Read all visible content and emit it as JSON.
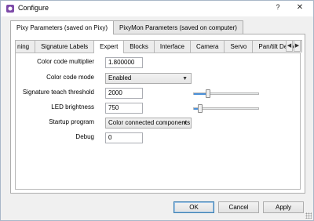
{
  "window": {
    "title": "Configure",
    "help_symbol": "?",
    "close_symbol": "✕"
  },
  "outer_tabs": [
    {
      "label": "Pixy Parameters (saved on Pixy)",
      "active": true
    },
    {
      "label": "PixyMon Parameters (saved on computer)",
      "active": false
    }
  ],
  "inner_tabs": [
    {
      "label": "ning",
      "active": false
    },
    {
      "label": "Signature Labels",
      "active": false
    },
    {
      "label": "Expert",
      "active": true
    },
    {
      "label": "Blocks",
      "active": false
    },
    {
      "label": "Interface",
      "active": false
    },
    {
      "label": "Camera",
      "active": false
    },
    {
      "label": "Servo",
      "active": false
    },
    {
      "label": "Pan/tilt Demo",
      "active": false
    }
  ],
  "tab_scroll": {
    "left": "◀",
    "right": "▶"
  },
  "fields": {
    "color_code_multiplier": {
      "label": "Color code multiplier",
      "value": "1.800000"
    },
    "color_code_mode": {
      "label": "Color code mode",
      "value": "Enabled"
    },
    "signature_teach_threshold": {
      "label": "Signature teach threshold",
      "value": "2000",
      "slider_fraction": 0.2
    },
    "led_brightness": {
      "label": "LED brightness",
      "value": "750",
      "slider_fraction": 0.08
    },
    "startup_program": {
      "label": "Startup program",
      "value": "Color connected components"
    },
    "debug": {
      "label": "Debug",
      "value": "0"
    }
  },
  "combo_arrow": "▼",
  "buttons": {
    "ok": "OK",
    "cancel": "Cancel",
    "apply": "Apply"
  },
  "colors": {
    "slider_fill": "#4a90d9",
    "default_button_border": "#3c7fb1"
  }
}
